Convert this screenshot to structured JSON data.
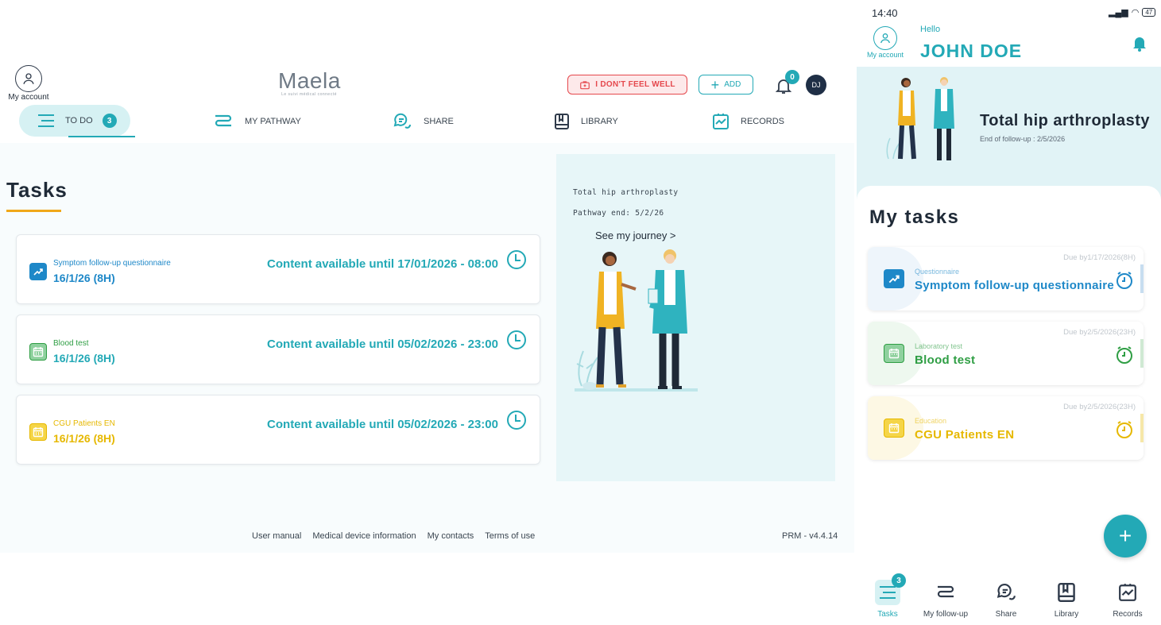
{
  "desktop": {
    "account_label": "My account",
    "logo": {
      "word": "Maela",
      "tagline": "Le suivi médical connecté"
    },
    "feel_unwell_label": "I DON'T FEEL WELL",
    "add_label": "ADD",
    "notifications_count": "0",
    "avatar_initials": "DJ",
    "nav": {
      "todo": "TO DO",
      "todo_count": "3",
      "pathway": "MY PATHWAY",
      "share": "SHARE",
      "library": "LIBRARY",
      "records": "RECORDS"
    },
    "tasks_title": "Tasks",
    "tasks": [
      {
        "name": "Symptom follow-up questionnaire",
        "date": "16/1/26 (8H)",
        "availability": "Content available until 17/01/2026 - 08:00",
        "color": "#1e88c8",
        "icon": "chart-up-icon"
      },
      {
        "name": "Blood test",
        "date": "16/1/26 (8H)",
        "availability": "Content available until 05/02/2026 - 23:00",
        "color": "#2f9e44",
        "icon": "calendar-icon"
      },
      {
        "name": "CGU Patients EN",
        "date": "16/1/26 (8H)",
        "availability": "Content available until 05/02/2026 - 23:00",
        "color": "#e6b800",
        "icon": "calendar-icon"
      }
    ],
    "side": {
      "pathway_name": "Total hip arthroplasty",
      "pathway_end": "Pathway end: 5/2/26",
      "journey_link": "See my journey >"
    },
    "footer": {
      "links": [
        "User manual",
        "Medical device information",
        "My contacts",
        "Terms of use"
      ],
      "version": "PRM - v4.4.14"
    }
  },
  "mobile": {
    "status_time": "14:40",
    "battery": "47",
    "account_label": "My account",
    "hello": "Hello",
    "username": "JOHN DOE",
    "hero_title": "Total hip arthroplasty",
    "hero_sub": "End of follow-up : 2/5/2026",
    "tasks_title": "My tasks",
    "tasks": [
      {
        "kind": "Questionnaire",
        "title": "Symptom follow-up questionnaire",
        "due": "Due by1/17/2026(8H)",
        "color": "#1e88c8",
        "tint": "#eef5fb",
        "icon": "chart-up-icon"
      },
      {
        "kind": "Laboratory test",
        "title": "Blood test",
        "due": "Due by2/5/2026(23H)",
        "color": "#2f9e44",
        "tint": "#eef8ef",
        "icon": "calendar-icon"
      },
      {
        "kind": "Education",
        "title": "CGU Patients EN",
        "due": "Due by2/5/2026(23H)",
        "color": "#e6b800",
        "tint": "#fdf8e4",
        "icon": "calendar-icon"
      }
    ],
    "fab_label": "+",
    "nav": {
      "tasks": "Tasks",
      "tasks_badge": "3",
      "follow_up": "My follow-up",
      "share": "Share",
      "library": "Library",
      "records": "Records"
    }
  },
  "colors": {
    "accent": "#23a9b6",
    "danger": "#e5484d",
    "underline": "#f0a81a"
  }
}
